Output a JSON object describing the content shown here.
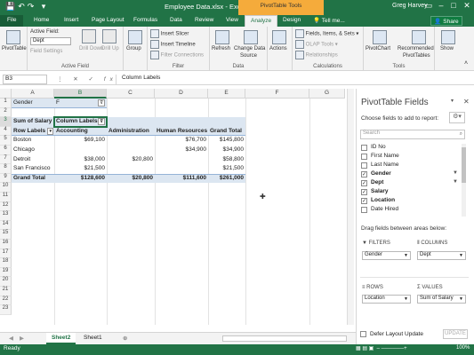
{
  "titlebar": {
    "title": "Employee Data.xlsx - Excel",
    "context_tool": "PivotTable Tools",
    "user": "Greg Harvey",
    "share": "Share",
    "brand_color": "#217346",
    "context_color": "#f5ab3b"
  },
  "tabs": {
    "file": "File",
    "home": "Home",
    "insert": "Insert",
    "page_layout": "Page Layout",
    "formulas": "Formulas",
    "data": "Data",
    "review": "Review",
    "view": "View",
    "analyze": "Analyze",
    "design": "Design",
    "tell_me": "Tell me..."
  },
  "ribbon": {
    "pivottable": "PivotTable",
    "active_field_label": "Active Field:",
    "active_field_value": "Dept",
    "field_settings": "Field Settings",
    "drill_down": "Drill Down",
    "drill_up": "Drill Up",
    "group": "Group",
    "group_active_field": "Active Field",
    "insert_slicer": "Insert Slicer",
    "insert_timeline": "Insert Timeline",
    "filter_connections": "Filter Connections",
    "group_filter": "Filter",
    "refresh": "Refresh",
    "change_data": "Change Data",
    "source": "Source",
    "group_data": "Data",
    "actions": "Actions",
    "fields_items_sets": "Fields, Items, & Sets",
    "olap_tools": "OLAP Tools",
    "relationships": "Relationships",
    "group_calculations": "Calculations",
    "pivotchart": "PivotChart",
    "recommended": "Recommended",
    "pivottables": "PivotTables",
    "group_tools": "Tools",
    "show": "Show"
  },
  "formula_bar": {
    "name_box": "B3",
    "value": "Column Labels"
  },
  "grid": {
    "columns": [
      "A",
      "B",
      "C",
      "D",
      "E",
      "F",
      "G"
    ],
    "rows": [
      "1",
      "2",
      "3",
      "4",
      "5",
      "6",
      "7",
      "8",
      "9",
      "10",
      "11",
      "12",
      "13",
      "14",
      "15",
      "16",
      "17",
      "18",
      "19",
      "20",
      "21",
      "22",
      "23"
    ],
    "a1": "Gender",
    "b1": "F",
    "a3": "Sum of Salary",
    "b3": "Column Labels",
    "header_row": [
      "Row Labels",
      "Accounting",
      "Administration",
      "Human Resources",
      "Grand Total"
    ],
    "data_rows": [
      [
        "Boston",
        "$69,100",
        "",
        "$76,700",
        "$145,800"
      ],
      [
        "Chicago",
        "",
        "",
        "$34,900",
        "$34,900"
      ],
      [
        "Detroit",
        "$38,000",
        "$20,800",
        "",
        "$58,800"
      ],
      [
        "San Francisco",
        "$21,500",
        "",
        "",
        "$21,500"
      ],
      [
        "Grand Total",
        "$128,600",
        "$20,800",
        "$111,600",
        "$261,000"
      ]
    ]
  },
  "sheets": {
    "active": "Sheet2",
    "other": "Sheet1"
  },
  "status": {
    "ready": "Ready",
    "zoom": "100%"
  },
  "pane": {
    "title": "PivotTable Fields",
    "choose": "Choose fields to add to report:",
    "search_placeholder": "Search",
    "fields": [
      {
        "label": "ID No",
        "checked": false,
        "filtered": false
      },
      {
        "label": "First Name",
        "checked": false,
        "filtered": false
      },
      {
        "label": "Last Name",
        "checked": false,
        "filtered": false
      },
      {
        "label": "Gender",
        "checked": true,
        "filtered": true
      },
      {
        "label": "Dept",
        "checked": true,
        "filtered": true
      },
      {
        "label": "Salary",
        "checked": true,
        "filtered": false
      },
      {
        "label": "Location",
        "checked": true,
        "filtered": false
      },
      {
        "label": "Date Hired",
        "checked": false,
        "filtered": false
      }
    ],
    "drag_text": "Drag fields between areas below:",
    "filters_label": "FILTERS",
    "columns_label": "COLUMNS",
    "rows_label": "ROWS",
    "values_label": "VALUES",
    "filters_value": "Gender",
    "columns_value": "Dept",
    "rows_value": "Location",
    "values_value": "Sum of Salary",
    "defer": "Defer Layout Update",
    "update": "UPDATE"
  }
}
